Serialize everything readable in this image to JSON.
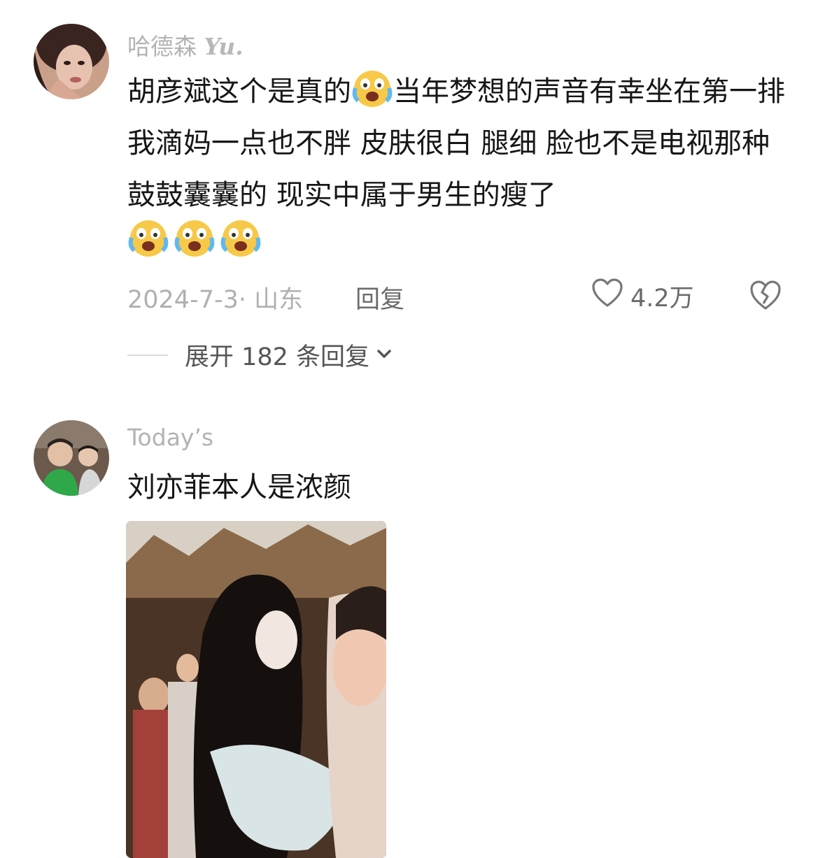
{
  "comments": [
    {
      "username": "哈德森",
      "username_suffix": "Yu.",
      "text": "胡彦斌这个是真的",
      "text_after_emoji": "当年梦想的声音有幸坐在第一排 我滴妈一点也不胖 皮肤很白 腿细 脸也不是电视那种鼓鼓囊囊的 现实中属于男生的瘦了",
      "emoji_name": "crying-laughing-emoji",
      "trailing_emoji_count": 3,
      "date": "2024-7-3",
      "location": "· 山东",
      "reply_label": "回复",
      "likes": "4.2万",
      "expand_label": "展开 182 条回复"
    },
    {
      "username": "Today’s",
      "text": "刘亦菲本人是浓颜"
    }
  ]
}
